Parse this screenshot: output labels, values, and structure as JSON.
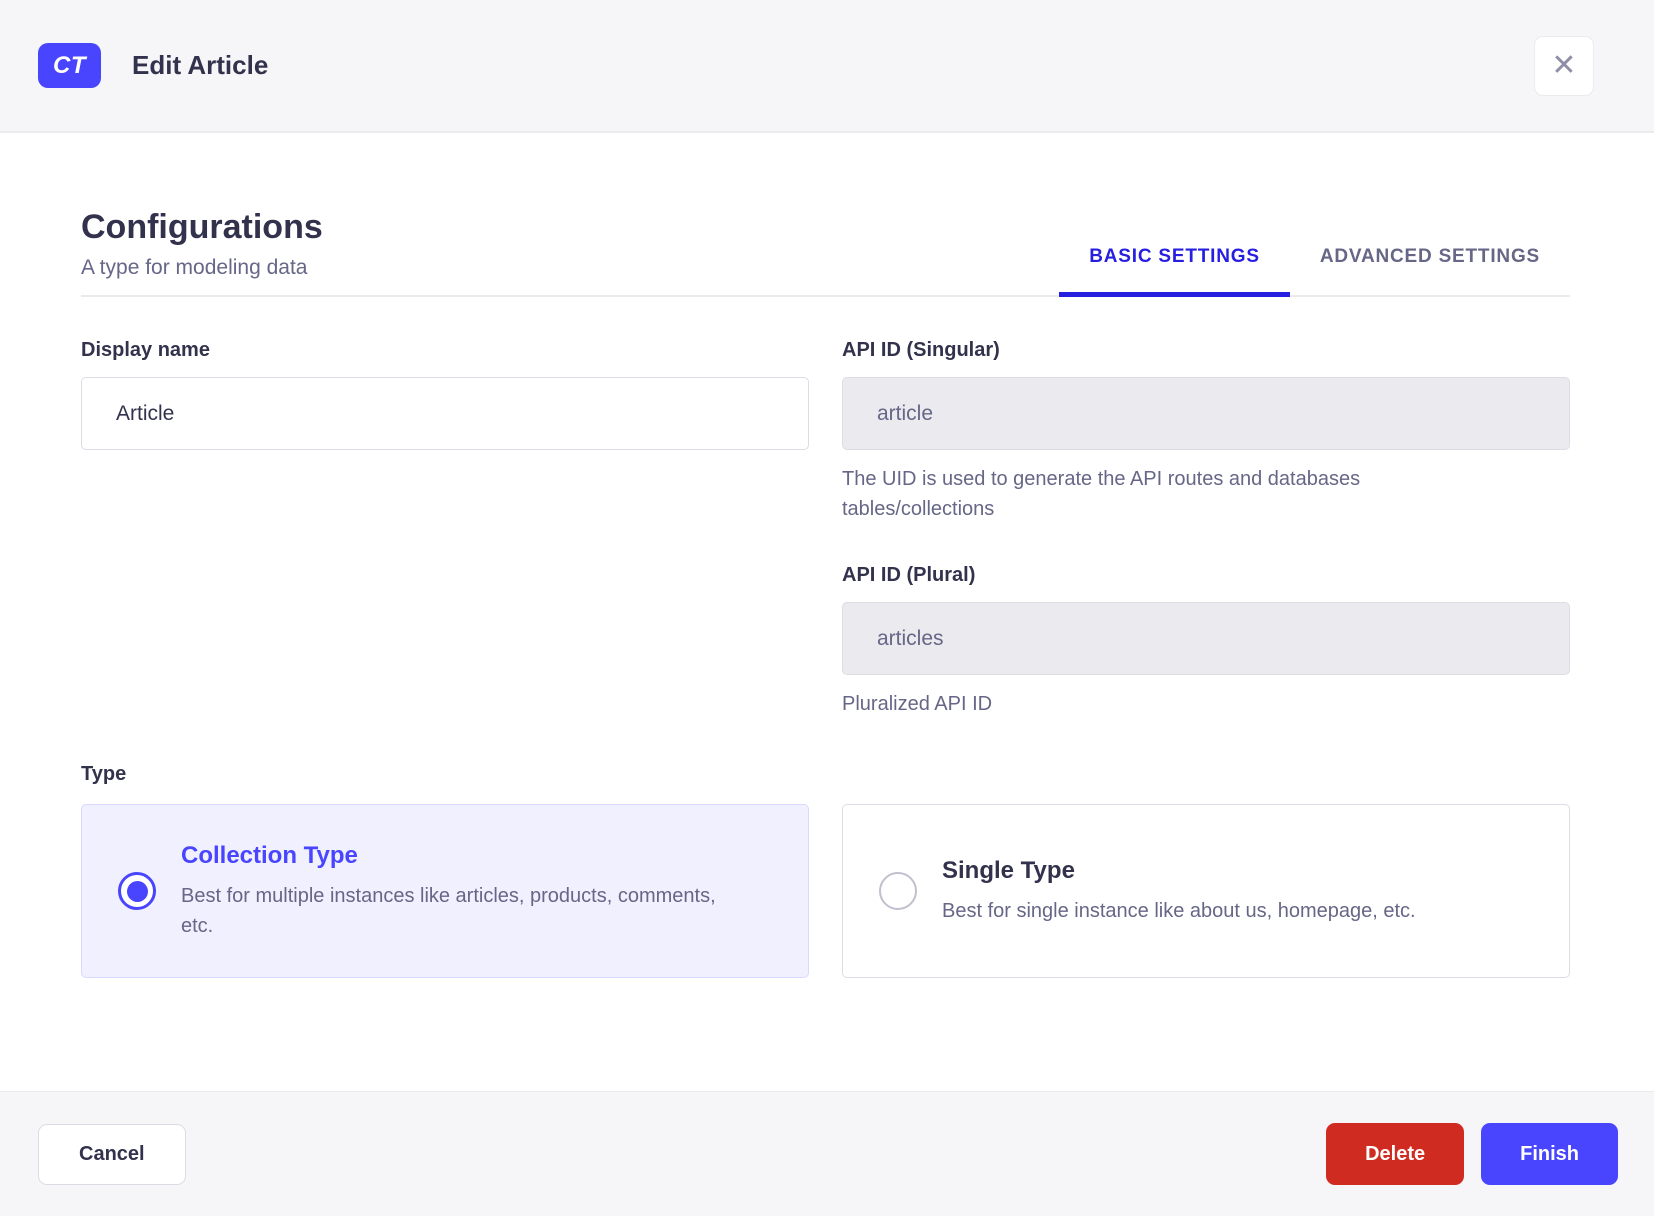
{
  "header": {
    "badge": "CT",
    "title": "Edit Article"
  },
  "icons": {
    "close": "✕"
  },
  "section": {
    "title": "Configurations",
    "subtitle": "A type for modeling data"
  },
  "tabs": [
    {
      "label": "BASIC SETTINGS",
      "active": true
    },
    {
      "label": "ADVANCED SETTINGS",
      "active": false
    }
  ],
  "form": {
    "display_name": {
      "label": "Display name",
      "value": "Article"
    },
    "api_id_singular": {
      "label": "API ID (Singular)",
      "value": "article",
      "hint": "The UID is used to generate the API routes and databases tables/collections"
    },
    "api_id_plural": {
      "label": "API ID (Plural)",
      "value": "articles",
      "hint": "Pluralized API ID"
    },
    "type": {
      "label": "Type",
      "options": [
        {
          "title": "Collection Type",
          "description": "Best for multiple instances like articles, products, comments, etc.",
          "selected": true
        },
        {
          "title": "Single Type",
          "description": "Best for single instance like about us, homepage, etc.",
          "selected": false
        }
      ]
    }
  },
  "footer": {
    "cancel": "Cancel",
    "delete": "Delete",
    "finish": "Finish"
  },
  "colors": {
    "primary": "#4945ff",
    "tab_active": "#271fe0",
    "danger": "#d02b20",
    "header_bg": "#f6f6f9",
    "text_dark": "#32324d",
    "text_gray": "#666687",
    "border": "#dcdce4",
    "divider": "#eaeaef",
    "card_selected_bg": "#f0f0ff",
    "card_selected_border": "#d9d8ff"
  }
}
